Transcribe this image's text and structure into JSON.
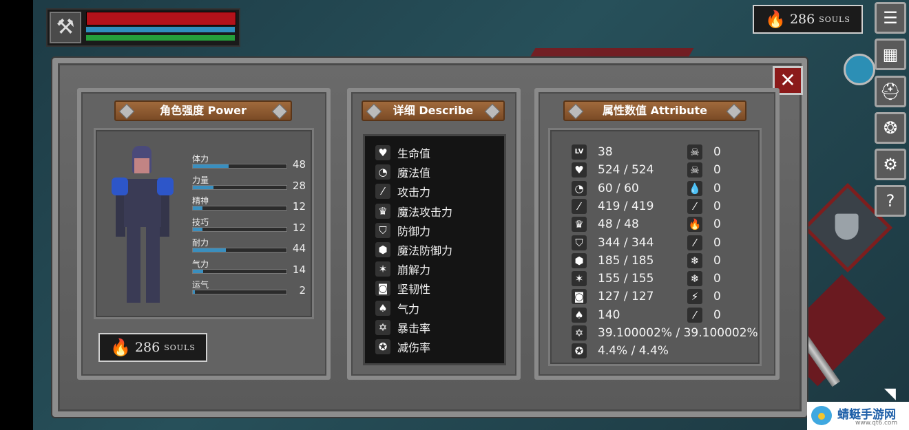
{
  "hud": {
    "weapon_icon": "axe-icon"
  },
  "top_souls": {
    "count": "286",
    "label": "SOULS"
  },
  "menu": [
    "menu-list-icon",
    "map-icon",
    "helmet-icon",
    "skill-icon",
    "gear-icon",
    "help-icon"
  ],
  "panels": {
    "power": {
      "title": "角色强度 Power",
      "stats": [
        {
          "name": "体力",
          "value": "48",
          "fill": 0.38
        },
        {
          "name": "力量",
          "value": "28",
          "fill": 0.22
        },
        {
          "name": "精神",
          "value": "12",
          "fill": 0.1
        },
        {
          "name": "技巧",
          "value": "12",
          "fill": 0.1
        },
        {
          "name": "耐力",
          "value": "44",
          "fill": 0.35
        },
        {
          "name": "气力",
          "value": "14",
          "fill": 0.11
        },
        {
          "name": "运气",
          "value": "2",
          "fill": 0.02
        }
      ],
      "souls": {
        "count": "286",
        "label": "SOULS"
      }
    },
    "describe": {
      "title": "详细 Describe",
      "items": [
        "生命值",
        "魔法值",
        "攻击力",
        "魔法攻击力",
        "防御力",
        "魔法防御力",
        "崩解力",
        "坚韧性",
        "气力",
        "暴击率",
        "减伤率"
      ]
    },
    "attribute": {
      "title": "属性数值 Attribute",
      "lv_label": "LV",
      "left": [
        "38",
        "524 / 524",
        "60 / 60",
        "419 / 419",
        "48 / 48",
        "344 / 344",
        "185 / 185",
        "155 / 155",
        "127 / 127",
        "140",
        "39.100002% / 39.100002%",
        "4.4% / 4.4%"
      ],
      "right": [
        "0",
        "0",
        "0",
        "0",
        "0",
        "0",
        "0",
        "0",
        "0",
        "0"
      ]
    }
  },
  "watermark": {
    "name": "蜻蜓手游网",
    "url": "www.qt6.com"
  }
}
